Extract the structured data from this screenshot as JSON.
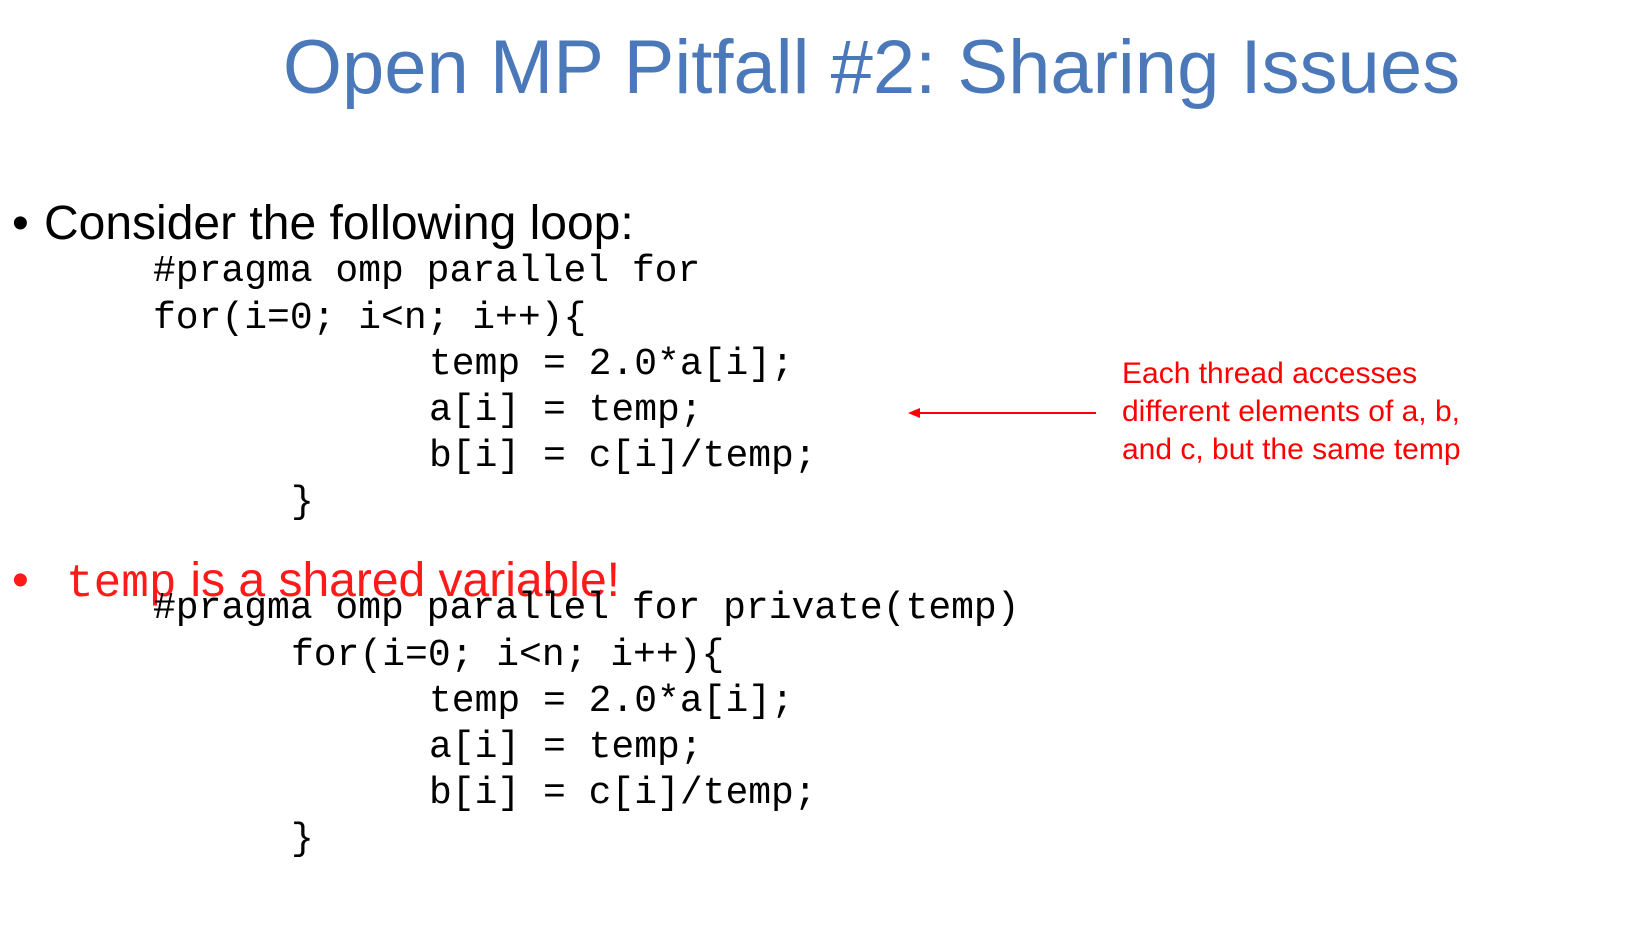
{
  "title": "Open MP Pitfall #2: Sharing Issues",
  "bullet1": {
    "marker": "•",
    "text": "Consider the following loop:"
  },
  "code1": {
    "lines": [
      "#pragma omp parallel for",
      "for(i=0; i<n; i++){",
      "temp = 2.0*a[i];",
      "a[i] = temp;",
      "b[i] = c[i]/temp;",
      "}"
    ]
  },
  "annotation": {
    "lines": [
      "Each thread accesses",
      "different elements of a, b,",
      "and c, but the same temp"
    ],
    "arrow_icon": "left-arrow-icon"
  },
  "bullet2": {
    "marker": "•",
    "code_text": "temp",
    "text": "is a shared variable!"
  },
  "code2": {
    "lines": [
      "#pragma omp parallel for private(temp)",
      "for(i=0; i<n; i++){",
      "temp = 2.0*a[i];",
      "a[i] = temp;",
      "b[i] = c[i]/temp;",
      "}"
    ]
  },
  "colors": {
    "title": "#4a78b8",
    "accent_red": "#ff0000",
    "text": "#000000"
  }
}
